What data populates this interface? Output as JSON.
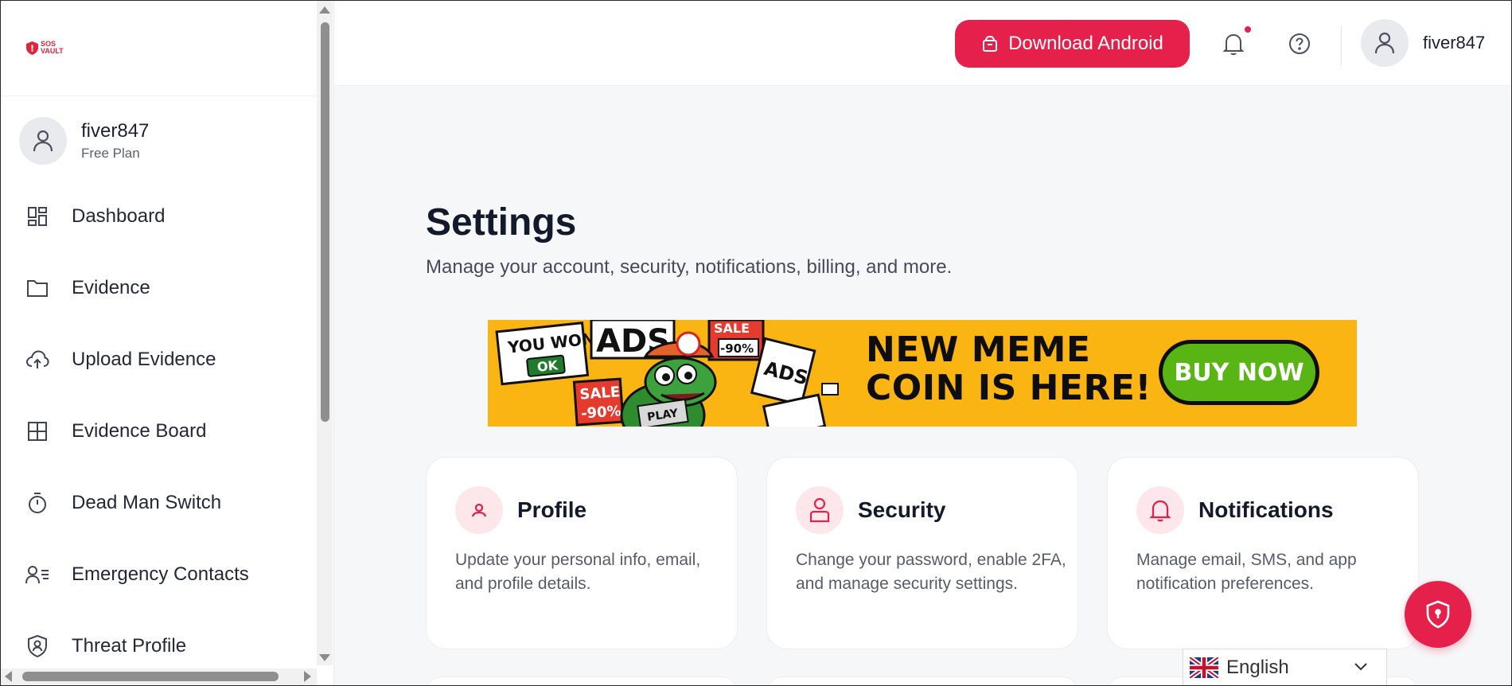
{
  "brand": {
    "logo_text_line1": "SOS",
    "logo_text_line2": "VAULT",
    "accent": "#e5204a"
  },
  "sidebar": {
    "user": {
      "name": "fiver847",
      "plan": "Free Plan"
    },
    "items": [
      {
        "label": "Dashboard",
        "icon": "dashboard-icon"
      },
      {
        "label": "Evidence",
        "icon": "folder-icon"
      },
      {
        "label": "Upload Evidence",
        "icon": "cloud-upload-icon"
      },
      {
        "label": "Evidence Board",
        "icon": "grid-icon"
      },
      {
        "label": "Dead Man Switch",
        "icon": "timer-icon"
      },
      {
        "label": "Emergency Contacts",
        "icon": "contacts-icon"
      },
      {
        "label": "Threat Profile",
        "icon": "shield-user-icon"
      }
    ]
  },
  "topbar": {
    "download_label": "Download Android",
    "username": "fiver847"
  },
  "main": {
    "title": "Settings",
    "subtitle": "Manage your account, security, notifications, billing, and more.",
    "ad": {
      "headline_line1": "NEW MEME",
      "headline_line2": "COIN IS HERE!",
      "cta": "BUY NOW",
      "sticker_won": "YOU WON!",
      "sticker_ok": "OK",
      "sticker_ads": "ADS",
      "sticker_sale": "SALE",
      "sticker_discount": "-90%",
      "sticker_play": "PLAY",
      "background_color": "#fbb512"
    },
    "cards": [
      {
        "title": "Profile",
        "description": "Update your personal info, email, and profile details.",
        "icon": "user-icon"
      },
      {
        "title": "Security",
        "description": "Change your password, enable 2FA, and manage security settings.",
        "icon": "lock-user-icon"
      },
      {
        "title": "Notifications",
        "description": "Manage email, SMS, and app notification preferences.",
        "icon": "bell-icon"
      }
    ]
  },
  "language": {
    "selected": "English",
    "flag": "uk-flag-icon"
  }
}
